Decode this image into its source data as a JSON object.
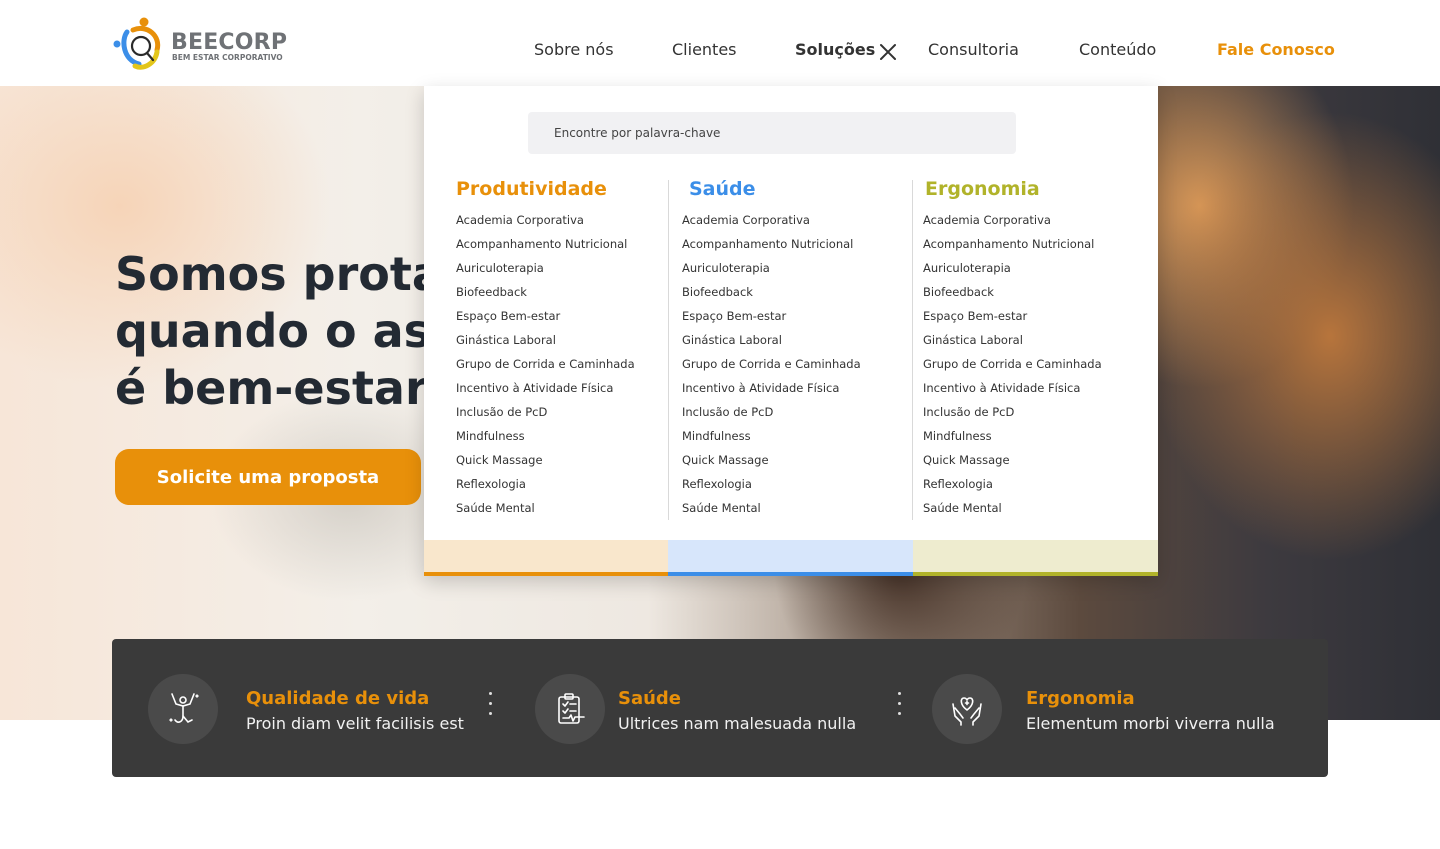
{
  "brand": {
    "name": "BEECORP",
    "tagline": "BEM ESTAR CORPORATIVO",
    "colors": {
      "orange": "#e8900a",
      "blue": "#3b8ee8",
      "olive": "#b1b32a",
      "dark": "#232a33"
    }
  },
  "nav": {
    "items": [
      "Sobre nós",
      "Clientes",
      "Soluções",
      "Consultoria",
      "Conteúdo"
    ],
    "active": "Soluções",
    "cta": "Fale Conosco",
    "close_icon": "close-icon"
  },
  "hero": {
    "title_lines": [
      "Somos prota",
      "quando o as",
      "é bem-estar."
    ],
    "cta_label": "Solicite uma proposta"
  },
  "dropdown": {
    "search_placeholder": "Encontre por palavra-chave",
    "columns": [
      {
        "title": "Produtividade",
        "color": "#e8900a",
        "footer_bg": "#f9e7cc",
        "items": [
          "Academia Corporativa",
          "Acompanhamento Nutricional",
          "Auriculoterapia",
          "Biofeedback",
          "Espaço Bem-estar",
          "Ginástica Laboral",
          "Grupo de Corrida e Caminhada",
          "Incentivo à Atividade Física",
          "Inclusão de PcD",
          "Mindfulness",
          "Quick Massage",
          "Reflexologia",
          "Saúde Mental"
        ]
      },
      {
        "title": "Saúde",
        "color": "#3b8ee8",
        "footer_bg": "#d7e6fb",
        "items": [
          "Academia Corporativa",
          "Acompanhamento Nutricional",
          "Auriculoterapia",
          "Biofeedback",
          "Espaço Bem-estar",
          "Ginástica Laboral",
          "Grupo de Corrida e Caminhada",
          "Incentivo à Atividade Física",
          "Inclusão de PcD",
          "Mindfulness",
          "Quick Massage",
          "Reflexologia",
          "Saúde Mental"
        ]
      },
      {
        "title": "Ergonomia",
        "color": "#b1b32a",
        "footer_bg": "#eeeccf",
        "items": [
          "Academia Corporativa",
          "Acompanhamento Nutricional",
          "Auriculoterapia",
          "Biofeedback",
          "Espaço Bem-estar",
          "Ginástica Laboral",
          "Grupo de Corrida e Caminhada",
          "Incentivo à Atividade Física",
          "Inclusão de PcD",
          "Mindfulness",
          "Quick Massage",
          "Reflexologia",
          "Saúde Mental"
        ]
      }
    ]
  },
  "features": [
    {
      "title": "Qualidade de vida",
      "subtitle": "Proin diam velit facilisis est",
      "icon": "stretch-person-icon"
    },
    {
      "title": "Saúde",
      "subtitle": "Ultrices nam malesuada nulla",
      "icon": "clipboard-heartbeat-icon"
    },
    {
      "title": "Ergonomia",
      "subtitle": "Elementum morbi viverra nulla",
      "icon": "hands-heart-icon"
    }
  ]
}
